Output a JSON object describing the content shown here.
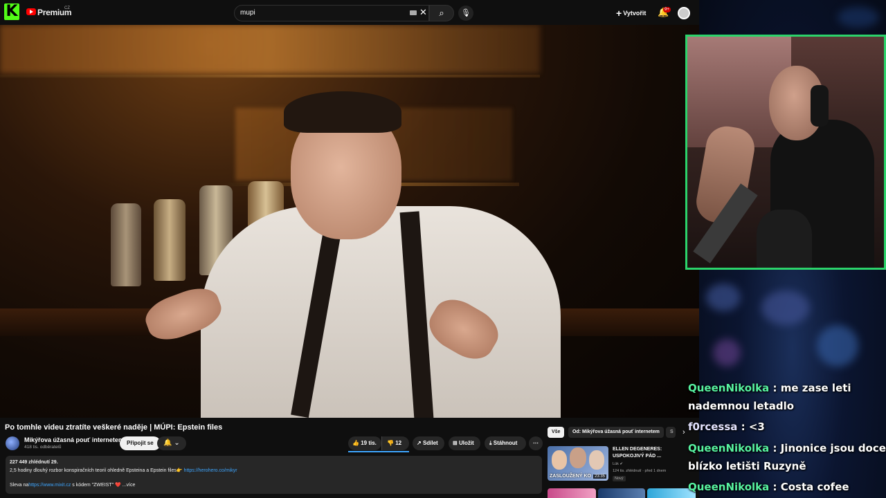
{
  "topbar": {
    "premium_label": "Premium",
    "region_label": "CZ",
    "search_value": "mupi",
    "create_label": "Vytvořit",
    "notification_count": "9+"
  },
  "video": {
    "title": "Po tomhle videu ztratíte veškeré naděje | MÚPI: Epstein files"
  },
  "channel": {
    "name": "Mikýřova úžasná pouť internetem",
    "subscribers": "418 tis. odběratelů",
    "join_label": "Připojit se"
  },
  "actions": {
    "likes": "19 tis.",
    "dislikes": "12",
    "share_label": "Sdílet",
    "save_label": "Uložit",
    "download_label": "Stáhnout"
  },
  "description": {
    "stats": "227 449 zhlédnutí  29.",
    "line1": "2,5 hodiny dlouhý rozbor konspiračních teorií ohledně Epsteina a Epstein files👉 ",
    "line1_link": "https://herohero.co/mikyr",
    "line2_prefix": "Sleva na",
    "line2_link": "https://www.mixit.cz",
    "line2_suffix": " s kódem \"ZWEIST\" ❤️  ...více"
  },
  "sidebar": {
    "chips": [
      "Vše",
      "Od: Mikýřova úžasná pouť internetem",
      "S"
    ],
    "related": {
      "title": "ELLEN DEGENERES: USPOKOJIVÝ PÁD ...",
      "channel": "Lük ✔",
      "meta": "124 tis. zhlédnutí · před 1 dnem",
      "badge": "Nový",
      "thumb_caption": "ZASLOUŽENÝ KO",
      "duration": "23:35"
    }
  },
  "chat": [
    {
      "user": "QueenNikolka",
      "text": " : me zase leti",
      "cont": "nademnou letadlo"
    },
    {
      "user": "f0rcessa",
      "text": " : <3"
    },
    {
      "user": "QueenNikolka",
      "text": " : Jinonice jsou docela",
      "cont": "blízko letišti Ruzyně"
    },
    {
      "user": "QueenNikolka",
      "text": " : Costa cofee"
    }
  ],
  "colors": {
    "kick_green": "#53fc18",
    "youtube_red": "#ff0000",
    "link_blue": "#3ea6ff",
    "chat_name_green": "#57f2a0",
    "webcam_border": "#2bd46b"
  }
}
